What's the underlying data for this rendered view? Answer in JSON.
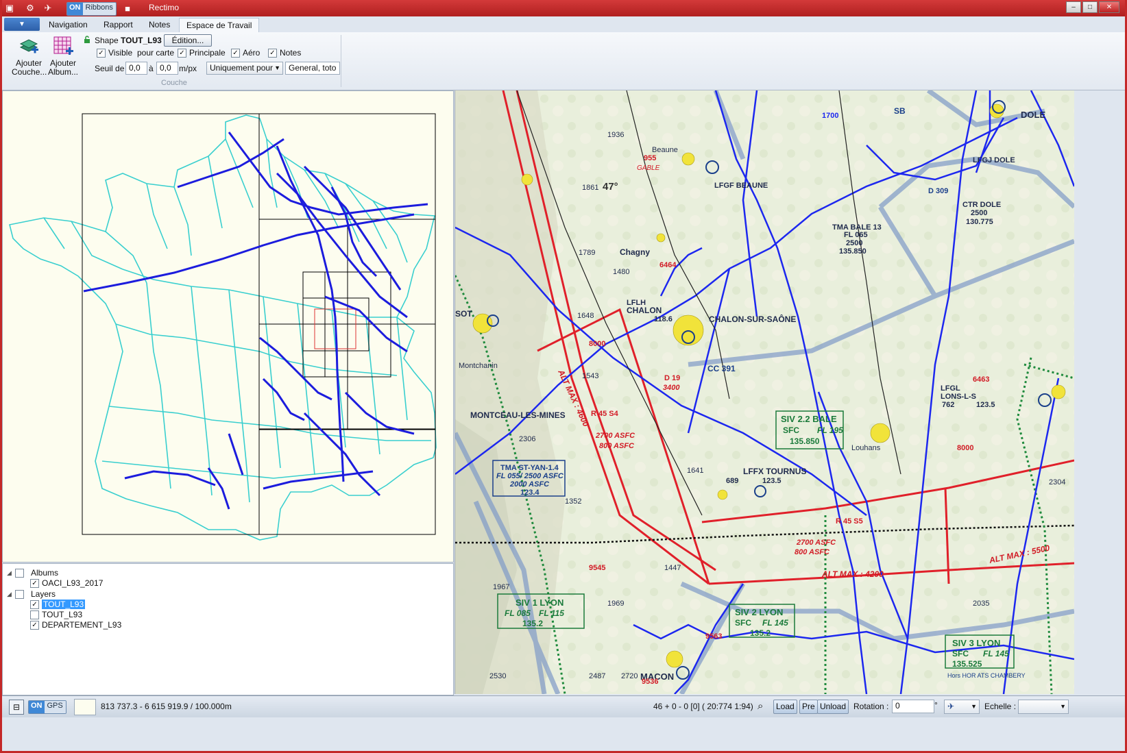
{
  "window": {
    "app_title": "Rectimo",
    "ribbons_toggle_on": "ON",
    "ribbons_toggle_label": "Ribbons"
  },
  "ribbon": {
    "tabs": [
      {
        "label": "Navigation"
      },
      {
        "label": "Rapport"
      },
      {
        "label": "Notes"
      },
      {
        "label": "Espace de Travail"
      }
    ],
    "add_layer_label": "Ajouter Couche...",
    "add_album_label": "Ajouter Album...",
    "shape_label": "Shape",
    "shape_name": "TOUT_L93",
    "edit_button": "Édition...",
    "visible_label": "Visible",
    "pour_carte_label": "pour carte",
    "principale_label": "Principale",
    "aero_label": "Aéro",
    "notes_label": "Notes",
    "seuil_label": "Seuil de",
    "seuil_from": "0,0",
    "a_label": "à",
    "seuil_to": "0,0",
    "unit_label": "m/px",
    "mode_select": "Uniquement pour",
    "mode_value": "General, toto",
    "group_label": "Couche"
  },
  "tree": {
    "albums_label": "Albums",
    "album_item": "OACI_L93_2017",
    "layers_label": "Layers",
    "layer_items": [
      {
        "label": "TOUT_L93",
        "checked": true,
        "selected": true
      },
      {
        "label": "TOUT_L93",
        "checked": false,
        "selected": false
      },
      {
        "label": "DEPARTEMENT_L93",
        "checked": true,
        "selected": false
      }
    ]
  },
  "status": {
    "on_label": "ON",
    "gps_label": "GPS",
    "coords": "813 737.3 - 6 615 919.9 / 100.000m",
    "tile_info": "46 + 0 - 0 [0]  ( 20:774  1:94)",
    "load_button": "Load",
    "pre_button": "Pre",
    "unload_button": "Unload",
    "rotation_label": "Rotation :",
    "rotation_value": "0",
    "degree_symbol": "°",
    "echelle_label": "Echelle :"
  },
  "map": {
    "labels": {
      "beaune": "Beaune",
      "lfgf_beaune": "LFGF BEAUNE",
      "dole": "DOLE",
      "lfgj_dole": "LFGJ DOLE",
      "ctr_dole": "CTR DOLE",
      "ctr_dole_alt": "2500",
      "ctr_dole_freq": "130.775",
      "tma_bale": "TMA BALE 13",
      "tma_bale_fl": "FL 065",
      "tma_bale_alt": "2500",
      "tma_bale_freq": "135.850",
      "chalon": "CHALON",
      "chalon_sur_saone": "CHALON-SUR-SAÔNE",
      "lfli_chalon": "LFLH",
      "chalon_freq": "118.6",
      "cc391": "CC 391",
      "siv22": "SIV 2.2 BALE",
      "siv22_sfc": "SFC",
      "siv22_fl": "FL 195",
      "siv22_freq": "135.850",
      "tma_st_yan": "TMA ST-YAN-1.4",
      "tma_st_yan_fl": "FL 055/ 2500 ASFC",
      "tma_st_yan_asfc": "2000 ASFC",
      "tma_st_yan_freq": "123.4",
      "montceau": "MONTCEAU-LES-MINES",
      "montchanin": "Montchanin",
      "lffx_tournus": "LFFX TOURNUS",
      "tournus_code": "689",
      "tournus_freq": "123.5",
      "siv1_lyon": "SIV 1 LYON",
      "siv1_fl1": "FL 085",
      "siv1_fl2": "FL 115",
      "siv1_freq": "135.2",
      "siv2_lyon": "SIV 2 LYON",
      "siv2_sfc": "SFC",
      "siv2_fl": "FL 145",
      "siv2_freq": "135.2",
      "siv3_lyon": "SIV 3 LYON",
      "siv3_sfc": "SFC",
      "siv3_fl": "FL 145",
      "siv3_freq": "135.525",
      "siv3_note": "Hors HOR ATS CHAMBERY",
      "macon": "MACON",
      "lons": "LONS-L-S",
      "lfgl": "LFGL",
      "lons_code": "762",
      "lons_freq": "123.5",
      "louhans": "Louhans",
      "altmax4600": "ALT MAX : 4600",
      "altmax4200": "ALT MAX : 4200",
      "altmax5500": "ALT MAX : 5500",
      "r45s4": "R 45 S4",
      "r45s4_alt1": "2700 ASFC",
      "r45s4_alt2": "800 ASFC",
      "r45s5": "R 45 S5",
      "r45s5_alt1": "2700 ASFC",
      "r45s5_alt2": "800 ASFC",
      "d19": "D 19",
      "d19_alt": "3400",
      "lat47": "47°",
      "n955": "955",
      "gable": "GABLE",
      "n6464": "6464",
      "n8000": "8000",
      "n6463": "6463",
      "n9545": "9545",
      "n9563": "9563",
      "n1700": "1700",
      "sb": "SB",
      "d309": "D 309",
      "n1936": "1936",
      "n1861": "1861",
      "n1789": "1789",
      "n1480": "1480",
      "n1648": "1648",
      "n1543": "1543",
      "n1641": "1641",
      "n1447": "1447",
      "n1969": "1969",
      "n1967": "1967",
      "n2035": "2035",
      "n2487": "2487",
      "n2530": "2530",
      "n2304": "2304",
      "n1352": "1352",
      "n2306": "2306",
      "n2720": "2720",
      "n9536": "9536",
      "chagny": "Chagny",
      "sot": "SOT"
    }
  }
}
